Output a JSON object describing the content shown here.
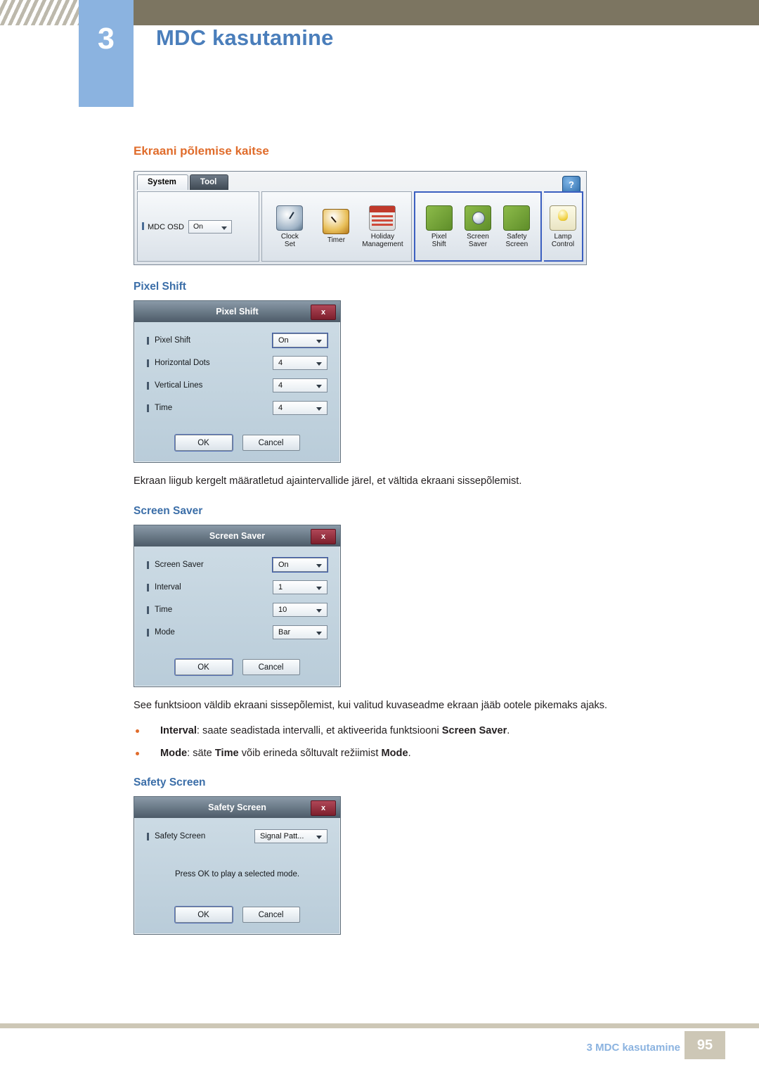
{
  "header": {
    "chapter_number": "3",
    "chapter_title": "MDC kasutamine"
  },
  "content": {
    "section_heading": "Ekraani põlemise kaitse",
    "toolbar": {
      "tabs": [
        {
          "label": "System",
          "state": "active"
        },
        {
          "label": "Tool",
          "state": "dark"
        }
      ],
      "help_label": "?",
      "osd_label": "MDC OSD",
      "osd_value": "On",
      "items": [
        {
          "icon": "clock-icon",
          "label_line1": "Clock",
          "label_line2": "Set"
        },
        {
          "icon": "timer-icon",
          "label_line1": "Timer",
          "label_line2": ""
        },
        {
          "icon": "holiday-icon",
          "label_line1": "Holiday",
          "label_line2": "Management"
        },
        {
          "icon": "pixel-shift-icon",
          "label_line1": "Pixel",
          "label_line2": "Shift"
        },
        {
          "icon": "screen-saver-icon",
          "label_line1": "Screen",
          "label_line2": "Saver"
        },
        {
          "icon": "safety-screen-icon",
          "label_line1": "Safety",
          "label_line2": "Screen"
        },
        {
          "icon": "lamp-control-icon",
          "label_line1": "Lamp",
          "label_line2": "Control"
        }
      ]
    },
    "pixel_shift": {
      "heading": "Pixel Shift",
      "dialog": {
        "title": "Pixel Shift",
        "close_label": "x",
        "rows": [
          {
            "label": "Pixel Shift",
            "value": "On"
          },
          {
            "label": "Horizontal Dots",
            "value": "4"
          },
          {
            "label": "Vertical Lines",
            "value": "4"
          },
          {
            "label": "Time",
            "value": "4"
          }
        ],
        "ok_label": "OK",
        "cancel_label": "Cancel"
      },
      "description": "Ekraan liigub kergelt määratletud ajaintervallide järel, et vältida ekraani sissepõlemist."
    },
    "screen_saver": {
      "heading": "Screen Saver",
      "dialog": {
        "title": "Screen Saver",
        "close_label": "x",
        "rows": [
          {
            "label": "Screen Saver",
            "value": "On"
          },
          {
            "label": "Interval",
            "value": "1"
          },
          {
            "label": "Time",
            "value": "10"
          },
          {
            "label": "Mode",
            "value": "Bar"
          }
        ],
        "ok_label": "OK",
        "cancel_label": "Cancel"
      },
      "description": "See funktsioon väldib ekraani sissepõlemist, kui valitud kuvaseadme ekraan jääb ootele pikemaks ajaks.",
      "bullets": [
        {
          "b1": "Interval",
          "t1": ": saate seadistada intervalli, et aktiveerida funktsiooni ",
          "b2": "Screen Saver",
          "t2": "."
        },
        {
          "b1": "Mode",
          "t1": ": säte ",
          "b2": "Time",
          "t2": " võib erineda sõltuvalt režiimist ",
          "b3": "Mode",
          "t3": "."
        }
      ]
    },
    "safety_screen": {
      "heading": "Safety Screen",
      "dialog": {
        "title": "Safety Screen",
        "close_label": "x",
        "rows": [
          {
            "label": "Safety Screen",
            "value": "Signal Patt..."
          }
        ],
        "note": "Press OK to play a selected mode.",
        "ok_label": "OK",
        "cancel_label": "Cancel"
      }
    }
  },
  "footer": {
    "label": "3 MDC kasutamine",
    "page_number": "95"
  },
  "colors": {
    "header_bar": "#7c7561",
    "chapter_box": "#8bb3e0",
    "chapter_title": "#4a7ebb",
    "section_heading": "#e06c2b",
    "sub_heading": "#3b6ea8",
    "footer_band": "#cdc7b6"
  }
}
